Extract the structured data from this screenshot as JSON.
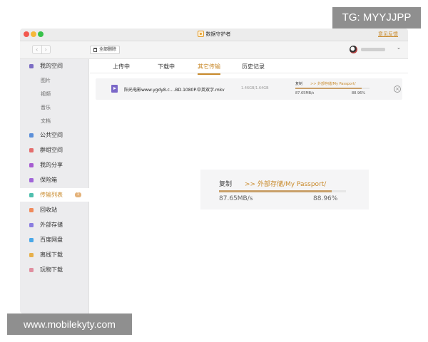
{
  "watermarks": {
    "top": "TG: MYYJJPP",
    "bottom": "www.mobilekyty.com"
  },
  "window": {
    "title": "数据守护者",
    "feedback": "意见反馈"
  },
  "toolbar": {
    "back": "‹",
    "forward": "›",
    "delete_all": "全部删除"
  },
  "sidebar": {
    "items": [
      {
        "label": "我的空间",
        "icon": "my-space-icon",
        "color": "#7b6cc4"
      },
      {
        "label": "图片",
        "sub": true
      },
      {
        "label": "视频",
        "sub": true
      },
      {
        "label": "音乐",
        "sub": true
      },
      {
        "label": "文档",
        "sub": true
      },
      {
        "label": "公共空间",
        "icon": "public-space-icon",
        "color": "#5b8fd9"
      },
      {
        "label": "群组空间",
        "icon": "group-space-icon",
        "color": "#e46d6d"
      },
      {
        "label": "我的分享",
        "icon": "share-icon",
        "color": "#a65cd1"
      },
      {
        "label": "保险箱",
        "icon": "safe-icon",
        "color": "#a065d8"
      },
      {
        "label": "传输列表",
        "icon": "transfer-icon",
        "color": "#4fbfae",
        "active": true,
        "badge": "1"
      },
      {
        "label": "回收站",
        "icon": "recycle-icon",
        "color": "#f08a5b"
      },
      {
        "label": "外部存储",
        "icon": "external-storage-icon",
        "color": "#8a7de0"
      },
      {
        "label": "百度网盘",
        "icon": "baidu-icon",
        "color": "#4aa8e8"
      },
      {
        "label": "离线下载",
        "icon": "offline-download-icon",
        "color": "#e7b04b"
      },
      {
        "label": "玩物下载",
        "icon": "wanwu-icon",
        "color": "#e08fa0"
      }
    ]
  },
  "tabs": [
    "上传中",
    "下载中",
    "其它传输",
    "历史记录"
  ],
  "active_tab": 2,
  "transfer": {
    "file_name": "阳光电影www.ygdy8.c....BD.1080P.中英双字.mkv",
    "size": "1.46GB/1.64GB",
    "operation": "复制",
    "destination": ">> 外部存储/My Passport/",
    "speed": "87.65MB/s",
    "percent": "88.96%",
    "progress": 0.8896
  },
  "colors": {
    "accent": "#c98a2b",
    "progress": "#c9a06a"
  }
}
